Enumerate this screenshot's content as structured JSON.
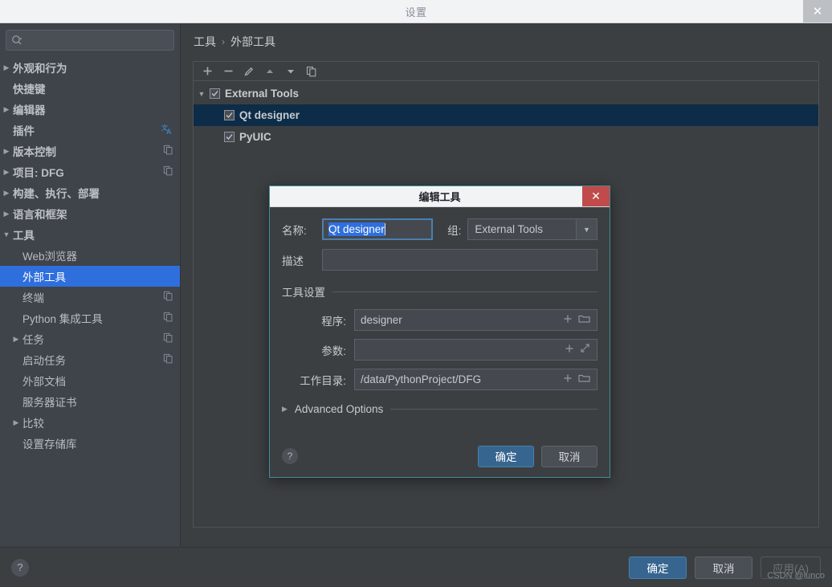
{
  "window": {
    "title": "设置",
    "close_icon": "close-icon"
  },
  "sidebar": {
    "search": {
      "value": "",
      "placeholder": "",
      "icon": "search-icon"
    },
    "items": [
      {
        "label": "外观和行为",
        "arrow": "▶",
        "depth": 0,
        "bold": true,
        "trail": "",
        "selected": false
      },
      {
        "label": "快捷键",
        "arrow": "",
        "depth": 0,
        "bold": true,
        "trail": "",
        "selected": false
      },
      {
        "label": "编辑器",
        "arrow": "▶",
        "depth": 0,
        "bold": true,
        "trail": "",
        "selected": false
      },
      {
        "label": "插件",
        "arrow": "",
        "depth": 0,
        "bold": true,
        "trail": "translate",
        "selected": false
      },
      {
        "label": "版本控制",
        "arrow": "▶",
        "depth": 0,
        "bold": true,
        "trail": "copy",
        "selected": false
      },
      {
        "label": "项目: DFG",
        "arrow": "▶",
        "depth": 0,
        "bold": true,
        "trail": "copy",
        "selected": false
      },
      {
        "label": "构建、执行、部署",
        "arrow": "▶",
        "depth": 0,
        "bold": true,
        "trail": "",
        "selected": false
      },
      {
        "label": "语言和框架",
        "arrow": "▶",
        "depth": 0,
        "bold": true,
        "trail": "",
        "selected": false
      },
      {
        "label": "工具",
        "arrow": "▼",
        "depth": 0,
        "bold": true,
        "trail": "",
        "selected": false
      },
      {
        "label": "Web浏览器",
        "arrow": "",
        "depth": 1,
        "bold": false,
        "trail": "",
        "selected": false
      },
      {
        "label": "外部工具",
        "arrow": "",
        "depth": 1,
        "bold": false,
        "trail": "",
        "selected": true
      },
      {
        "label": "终端",
        "arrow": "",
        "depth": 1,
        "bold": false,
        "trail": "copy",
        "selected": false
      },
      {
        "label": "Python 集成工具",
        "arrow": "",
        "depth": 1,
        "bold": false,
        "trail": "copy",
        "selected": false
      },
      {
        "label": "任务",
        "arrow": "▶",
        "depth": 1,
        "bold": false,
        "trail": "copy",
        "selected": false
      },
      {
        "label": "启动任务",
        "arrow": "",
        "depth": 1,
        "bold": false,
        "trail": "copy",
        "selected": false
      },
      {
        "label": "外部文档",
        "arrow": "",
        "depth": 1,
        "bold": false,
        "trail": "",
        "selected": false
      },
      {
        "label": "服务器证书",
        "arrow": "",
        "depth": 1,
        "bold": false,
        "trail": "",
        "selected": false
      },
      {
        "label": "比较",
        "arrow": "▶",
        "depth": 1,
        "bold": false,
        "trail": "",
        "selected": false
      },
      {
        "label": "设置存储库",
        "arrow": "",
        "depth": 1,
        "bold": false,
        "trail": "",
        "selected": false
      }
    ],
    "help_label": "?"
  },
  "main": {
    "breadcrumb": {
      "parent": "工具",
      "separator": "›",
      "current": "外部工具"
    },
    "toolbar": [
      {
        "name": "add-button",
        "glyph": "+"
      },
      {
        "name": "remove-button",
        "glyph": "−"
      },
      {
        "name": "edit-button",
        "glyph": "pencil"
      },
      {
        "name": "move-up-button",
        "glyph": "▲"
      },
      {
        "name": "move-down-button",
        "glyph": "▼"
      },
      {
        "name": "copy-button",
        "glyph": "copy"
      }
    ],
    "tree": [
      {
        "label": "External Tools",
        "arrow": "▼",
        "checked": true,
        "depth": 0,
        "selected": false
      },
      {
        "label": "Qt designer",
        "arrow": "",
        "checked": true,
        "depth": 1,
        "selected": true
      },
      {
        "label": "PyUIC",
        "arrow": "",
        "checked": true,
        "depth": 1,
        "selected": false
      }
    ]
  },
  "footer": {
    "ok_label": "确定",
    "cancel_label": "取消",
    "apply_label": "应用(A)"
  },
  "watermark": "CSDN @lunco",
  "dialog": {
    "title": "编辑工具",
    "close_icon": "close-icon",
    "name_label": "名称:",
    "name_value": "Qt designer",
    "group_label": "组:",
    "group_value": "External Tools",
    "desc_label": "描述",
    "desc_value": "",
    "section_title": "工具设置",
    "program_label": "程序:",
    "program_value": "designer",
    "arguments_label": "参数:",
    "arguments_value": "",
    "workdir_label": "工作目录:",
    "workdir_value": "/data/PythonProject/DFG",
    "advanced_label": "Advanced Options",
    "advanced_arrow": "▶",
    "help_label": "?",
    "ok_label": "确定",
    "cancel_label": "取消"
  },
  "colors": {
    "accent_blue": "#2f6fdd",
    "primary_button": "#36658f",
    "dialog_border": "#3f8ea0",
    "close_red": "#c14b4b",
    "selection_row": "#0d2c47"
  }
}
